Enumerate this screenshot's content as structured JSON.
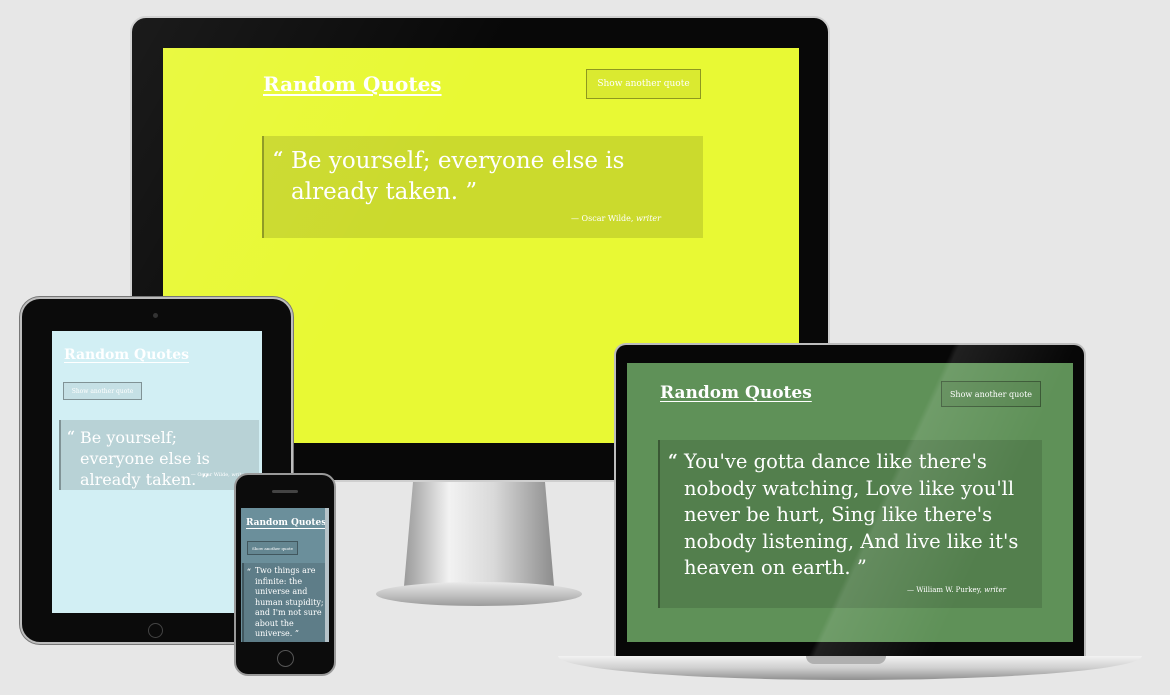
{
  "app": {
    "title": "Random Quotes",
    "button_label": "Show another quote"
  },
  "devices": {
    "monitor": {
      "bg_color": "#e8f934",
      "quote": "Be yourself; everyone else is already taken.",
      "author": "Oscar Wilde",
      "role": "writer"
    },
    "tablet": {
      "bg_color": "#d2eff4",
      "quote": "Be yourself; everyone else is already taken.",
      "author": "Oscar Wilde",
      "role": "writer"
    },
    "laptop": {
      "bg_color": "#5f9158",
      "quote": "You've gotta dance like there's nobody watching, Love like you'll never be hurt, Sing like there's nobody listening, And live like it's heaven on earth.",
      "author": "William W. Purkey",
      "role": "writer"
    },
    "phone": {
      "bg_color": "#6b8f9b",
      "quote": "Two things are infinite: the universe and human stupidity; and I'm not sure about the universe."
    }
  },
  "glyphs": {
    "open_quote": "“",
    "close_quote": "”",
    "dash": "— "
  }
}
